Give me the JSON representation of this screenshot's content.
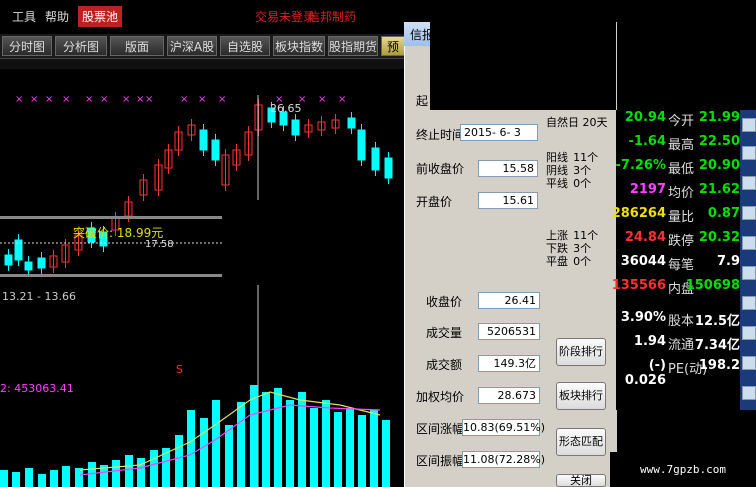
{
  "menu": {
    "tools": "工具",
    "help": "帮助",
    "stock_pool": "股票池",
    "status": "交易未登录",
    "broker": "信邦制药"
  },
  "tabs": [
    "分时图",
    "分析图",
    "版面",
    "沪深A股",
    "自选股",
    "板块指数",
    "股指期货",
    "预选"
  ],
  "chart": {
    "high_label": "26.65",
    "breakout_label": "突破价: 18.99元",
    "level_label": "17.58",
    "range_label": "13.21 - 13.66",
    "volume_label": "2: 453063.41",
    "s_marker": "S",
    "x_marker": "×"
  },
  "dialog": {
    "title": "信报",
    "start_label": "起",
    "end_label": "终止时间",
    "end_value": "2015- 6- 3",
    "natural_days": "自然日 20天",
    "prev_close_label": "前收盘价",
    "prev_close_value": "15.58",
    "open_label": "开盘价",
    "open_value": "15.61",
    "yang_label": "阳线",
    "yang_value": "11个",
    "yin_label": "阴线",
    "yin_value": "3个",
    "flat_line_label": "平线",
    "flat_line_value": "0个",
    "up_label": "上涨",
    "up_value": "11个",
    "down_label": "下跌",
    "down_value": "3个",
    "flat_label": "平盘",
    "flat_value": "0个",
    "close_label": "收盘价",
    "close_value": "26.41",
    "volume_label": "成交量",
    "volume_value": "5206531",
    "amount_label": "成交额",
    "amount_value": "149.3亿",
    "wavg_label": "加权均价",
    "wavg_value": "28.673",
    "range_rise_label": "区间涨幅",
    "range_rise_value": "10.83(69.51%)",
    "range_amp_label": "区间振幅",
    "range_amp_value": "11.08(72.28%)",
    "btn_stage_rank": "阶段排行",
    "btn_sector_rank": "板块排行",
    "btn_pattern": "形态匹配",
    "btn_close": "关闭"
  },
  "quote": {
    "rows": [
      {
        "v1": "20.94",
        "l1": "今开",
        "v2": "21.99",
        "c1": "#00e000",
        "c2": "#00e000"
      },
      {
        "v1": "-1.64",
        "l1": "最高",
        "v2": "22.50",
        "c1": "#00e000",
        "c2": "#00e000"
      },
      {
        "v1": "-7.26%",
        "l1": "最低",
        "v2": "20.90",
        "c1": "#00e000",
        "c2": "#00e000"
      },
      {
        "v1": "2197",
        "l1": "均价",
        "v2": "21.62",
        "c1": "#ff40ff",
        "c2": "#00e000"
      },
      {
        "v1": "286264",
        "l1": "量比",
        "v2": "0.87",
        "c1": "#f0e000",
        "c2": "#00e000"
      },
      {
        "v1": "24.84",
        "l1": "跌停",
        "v2": "20.32",
        "c1": "#ff3030",
        "c2": "#00e000"
      },
      {
        "v1": "36044",
        "l1": "每笔",
        "v2": "7.9",
        "c1": "#ffffff",
        "c2": "#ffffff"
      },
      {
        "v1": "135566",
        "l1": "内盘",
        "v2": "150698",
        "c1": "#ff3030",
        "c2": "#00e000"
      },
      {
        "v1": "3.90%",
        "l1": "股本",
        "v2": "12.5亿",
        "c1": "#ffffff",
        "c2": "#ffffff"
      },
      {
        "v1": "1.94",
        "l1": "流通",
        "v2": "7.34亿",
        "c1": "#ffffff",
        "c2": "#ffffff"
      },
      {
        "v1": "(-) 0.026",
        "l1": "PE(动)",
        "v2": "198.2",
        "c1": "#ffffff",
        "c2": "#ffffff"
      }
    ]
  },
  "watermark": "www.7gpzb.com"
}
